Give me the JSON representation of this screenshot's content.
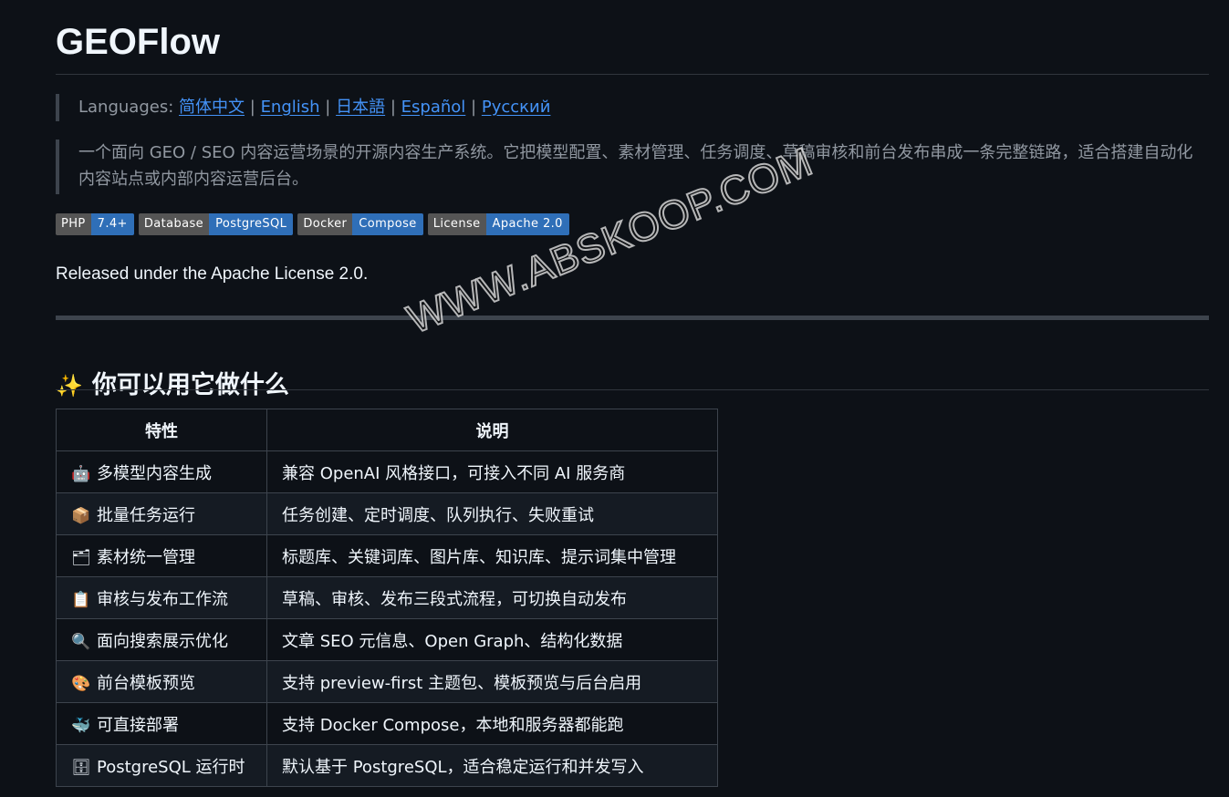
{
  "title": "GEOFlow",
  "languages": {
    "label": "Languages:",
    "links": [
      "简体中文",
      "English",
      "日本語",
      "Español",
      "Русский"
    ],
    "separator": "|"
  },
  "description": "一个面向 GEO / SEO 内容运营场景的开源内容生产系统。它把模型配置、素材管理、任务调度、草稿审核和前台发布串成一条完整链路，适合搭建自动化内容站点或内部内容运营后台。",
  "badges": [
    {
      "label": "PHP",
      "value": "7.4+"
    },
    {
      "label": "Database",
      "value": "PostgreSQL"
    },
    {
      "label": "Docker",
      "value": "Compose"
    },
    {
      "label": "License",
      "value": "Apache 2.0"
    }
  ],
  "license_text": "Released under the Apache License 2.0.",
  "section": {
    "icon": "sparkles-icon",
    "title": "你可以用它做什么"
  },
  "table": {
    "headers": [
      "特性",
      "说明"
    ],
    "rows": [
      {
        "icon": "robot-icon",
        "glyph": "🤖",
        "feature": "多模型内容生成",
        "desc": "兼容 OpenAI 风格接口，可接入不同 AI 服务商"
      },
      {
        "icon": "package-icon",
        "glyph": "📦",
        "feature": "批量任务运行",
        "desc": "任务创建、定时调度、队列执行、失败重试"
      },
      {
        "icon": "folder-icon",
        "glyph": "🗂",
        "feature": "素材统一管理",
        "desc": "标题库、关键词库、图片库、知识库、提示词集中管理"
      },
      {
        "icon": "clipboard-icon",
        "glyph": "📋",
        "feature": "审核与发布工作流",
        "desc": "草稿、审核、发布三段式流程，可切换自动发布"
      },
      {
        "icon": "magnifier-icon",
        "glyph": "🔍",
        "feature": "面向搜索展示优化",
        "desc": "文章 SEO 元信息、Open Graph、结构化数据"
      },
      {
        "icon": "palette-icon",
        "glyph": "🎨",
        "feature": "前台模板预览",
        "desc": "支持 preview-first 主题包、模板预览与后台启用"
      },
      {
        "icon": "whale-icon",
        "glyph": "🐳",
        "feature": "可直接部署",
        "desc": "支持 Docker Compose，本地和服务器都能跑"
      },
      {
        "icon": "cabinet-icon",
        "glyph": "🗄",
        "feature": "PostgreSQL 运行时",
        "desc": "默认基于 PostgreSQL，适合稳定运行和并发写入"
      }
    ]
  },
  "watermark": "WWW.ABSKOOP.COM"
}
